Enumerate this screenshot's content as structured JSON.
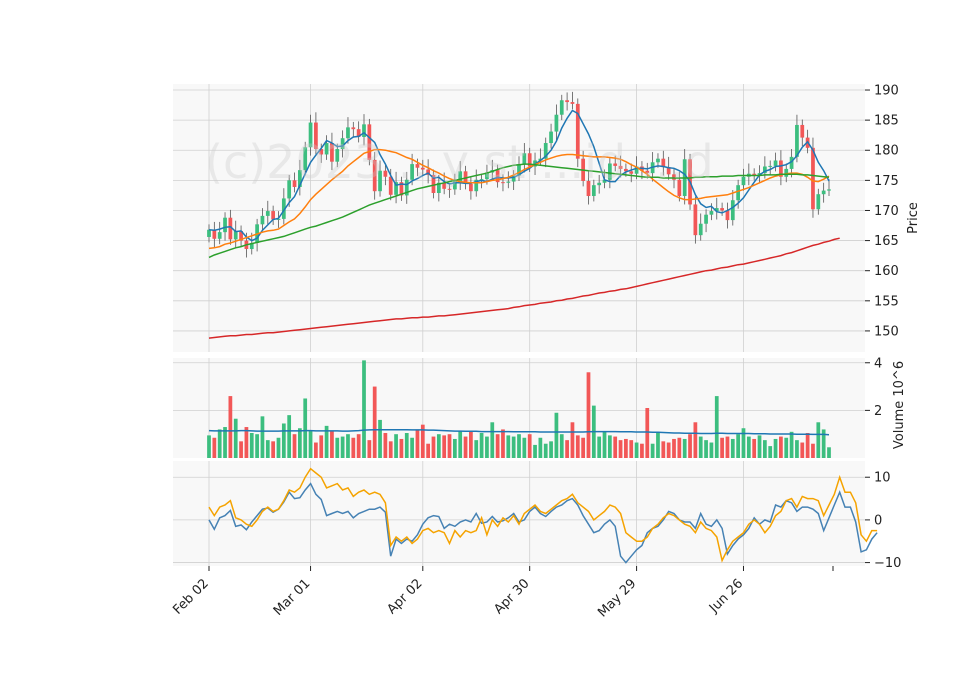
{
  "chart_data": {
    "type": "candlestick",
    "watermark": "(c)2023 ...y st ...id ...d",
    "x_tick_labels": [
      "Feb 02",
      "Mar 01",
      "Apr 02",
      "Apr 30",
      "May 29",
      "Jun 26"
    ],
    "x_tick_index": [
      0,
      19,
      40,
      60,
      80,
      100
    ],
    "colors": {
      "up": "#3cbe7f",
      "down": "#f25757",
      "ma_fast": "#1f77b4",
      "ma_mid": "#ff7f0e",
      "ma_slow": "#2ca02c",
      "ma_long": "#d62728",
      "vol_ma": "#1f77b4",
      "osc_a": "#4682b4",
      "osc_b": "#f5a300",
      "grid": "#d0d0d0",
      "panel_bg": "#f8f8f8"
    },
    "price_panel": {
      "ylabel": "Price",
      "ylim": [
        146.5,
        191
      ],
      "ticks": [
        150,
        155,
        160,
        165,
        170,
        175,
        180,
        185,
        190
      ],
      "close": [
        166.8,
        165.3,
        166.4,
        168.8,
        165.2,
        166.6,
        165.0,
        163.6,
        164.6,
        167.7,
        169.1,
        169.9,
        168.5,
        168.6,
        172.0,
        175.0,
        173.9,
        176.7,
        180.5,
        184.6,
        180.2,
        179.3,
        181.2,
        178.1,
        180.2,
        182.0,
        183.8,
        183.5,
        182.2,
        184.3,
        178.4,
        173.2,
        176.6,
        175.6,
        172.6,
        174.7,
        172.5,
        175.1,
        177.7,
        177.1,
        176.8,
        175.9,
        172.9,
        174.6,
        173.6,
        173.5,
        174.8,
        176.5,
        174.4,
        173.2,
        175.1,
        175.2,
        176.3,
        176.7,
        174.7,
        174.6,
        174.8,
        175.8,
        177.7,
        179.5,
        177.3,
        178.3,
        178.6,
        181.2,
        183.1,
        185.9,
        188.3,
        188.0,
        187.7,
        178.6,
        174.9,
        172.4,
        174.2,
        174.6,
        175.1,
        177.8,
        177.4,
        176.9,
        176.5,
        176.1,
        177.3,
        176.6,
        176.2,
        178.0,
        178.6,
        177.2,
        176.0,
        175.1,
        172.4,
        178.5,
        171.0,
        165.9,
        167.8,
        169.3,
        169.9,
        170.4,
        170.0,
        168.4,
        171.7,
        174.2,
        175.6,
        176.1,
        175.9,
        176.2,
        177.3,
        177.4,
        178.3,
        175.6,
        176.9,
        178.9,
        184.2,
        182.1,
        180.4,
        170.2,
        172.7,
        173.3,
        173.5
      ],
      "moving_averages": [
        {
          "period": 5,
          "values": [
            166.8,
            166.7,
            166.9,
            167.2,
            167.3,
            166.5,
            166.6,
            165.6,
            165.0,
            165.4,
            166.7,
            167.6,
            168.5,
            168.7,
            170.0,
            171.3,
            172.3,
            174.2,
            176.1,
            178.0,
            179.2,
            180.3,
            181.6,
            181.2,
            180.6,
            180.7,
            181.6,
            182.2,
            182.3,
            182.9,
            182.1,
            181.3,
            179.3,
            177.7,
            175.8,
            174.2,
            174.4,
            174.3,
            174.9,
            175.3,
            175.8,
            176.2,
            175.4,
            175.5,
            174.8,
            174.4,
            174.6,
            174.6,
            174.5,
            174.5,
            174.8,
            175.0,
            174.8,
            175.2,
            175.5,
            175.4,
            175.4,
            175.5,
            175.9,
            176.5,
            177.0,
            177.7,
            178.3,
            179.0,
            180.0,
            181.5,
            183.7,
            185.3,
            186.6,
            186.1,
            184.4,
            182.7,
            180.6,
            177.8,
            175.1,
            174.8,
            174.8,
            175.8,
            176.4,
            176.7,
            177.0,
            177.0,
            176.9,
            177.2,
            177.4,
            177.3,
            177.1,
            177.0,
            176.6,
            176.0,
            174.8,
            172.6,
            171.1,
            170.5,
            170.7,
            169.8,
            169.6,
            170.0,
            170.5,
            171.2,
            172.1,
            173.4,
            174.7,
            175.9,
            176.5,
            176.8,
            177.3,
            177.4,
            177.6,
            178.1,
            179.1,
            180.5,
            181.4,
            180.0,
            178.0,
            176.6,
            174.9
          ]
        },
        {
          "period": 20,
          "values": [
            163.7,
            163.8,
            164.0,
            164.4,
            164.6,
            164.9,
            165.2,
            165.5,
            165.8,
            166.1,
            166.4,
            166.6,
            166.7,
            166.9,
            167.5,
            168.1,
            168.6,
            169.5,
            170.6,
            171.8,
            172.7,
            173.5,
            174.3,
            175.1,
            175.8,
            176.5,
            177.4,
            178.1,
            178.8,
            179.5,
            179.8,
            180.1,
            180.1,
            180.0,
            179.8,
            179.6,
            179.2,
            178.8,
            178.5,
            178.0,
            177.5,
            177.1,
            176.6,
            176.2,
            175.7,
            175.3,
            175.0,
            174.8,
            174.7,
            174.6,
            174.6,
            174.6,
            174.8,
            175.0,
            175.1,
            175.3,
            175.5,
            175.9,
            176.3,
            176.8,
            177.2,
            177.6,
            178.0,
            178.4,
            178.7,
            179.0,
            179.2,
            179.3,
            179.3,
            179.2,
            179.1,
            179.0,
            178.9,
            178.9,
            178.9,
            178.8,
            178.7,
            178.5,
            178.1,
            177.6,
            177.2,
            176.6,
            176.0,
            175.2,
            174.5,
            173.8,
            173.1,
            172.5,
            172.1,
            171.8,
            171.8,
            171.9,
            172.0,
            172.2,
            172.3,
            172.4,
            172.5,
            172.6,
            172.9,
            173.2,
            173.5,
            173.8,
            174.2,
            174.6,
            175.0,
            175.4,
            175.7,
            175.9,
            176.1,
            176.2,
            176.2,
            176.0,
            175.5,
            174.9,
            174.8,
            175.2,
            175.7
          ]
        },
        {
          "period": 50,
          "values": [
            162.2,
            162.6,
            162.9,
            163.2,
            163.5,
            163.8,
            164.0,
            164.3,
            164.5,
            164.7,
            164.9,
            165.1,
            165.3,
            165.5,
            165.7,
            166.0,
            166.3,
            166.6,
            166.9,
            167.2,
            167.4,
            167.7,
            168.0,
            168.3,
            168.6,
            168.9,
            169.3,
            169.7,
            170.1,
            170.5,
            170.9,
            171.2,
            171.5,
            171.8,
            172.1,
            172.4,
            172.7,
            173.0,
            173.3,
            173.6,
            173.8,
            174.0,
            174.2,
            174.4,
            174.6,
            174.8,
            175.0,
            175.2,
            175.4,
            175.6,
            175.8,
            176.0,
            176.2,
            176.5,
            176.8,
            177.1,
            177.3,
            177.5,
            177.6,
            177.7,
            177.7,
            177.6,
            177.5,
            177.4,
            177.3,
            177.2,
            177.1,
            177.0,
            176.9,
            176.8,
            176.7,
            176.6,
            176.5,
            176.4,
            176.3,
            176.2,
            176.1,
            176.0,
            175.9,
            175.8,
            175.7,
            175.6,
            175.5,
            175.5,
            175.5,
            175.4,
            175.4,
            175.4,
            175.4,
            175.4,
            175.4,
            175.5,
            175.5,
            175.6,
            175.6,
            175.6,
            175.7,
            175.7,
            175.7,
            175.8,
            175.8,
            175.8,
            175.8,
            175.8,
            175.9,
            175.9,
            175.9,
            176.0,
            176.0,
            176.0,
            176.0,
            175.9,
            175.9,
            175.8,
            175.7,
            175.6,
            175.5
          ]
        },
        {
          "period": 200,
          "values": [
            148.8,
            148.9,
            149.0,
            149.1,
            149.2,
            149.2,
            149.3,
            149.4,
            149.4,
            149.5,
            149.6,
            149.7,
            149.7,
            149.8,
            149.9,
            150.0,
            150.1,
            150.2,
            150.3,
            150.4,
            150.5,
            150.6,
            150.7,
            150.8,
            150.9,
            151.0,
            151.1,
            151.2,
            151.3,
            151.4,
            151.5,
            151.6,
            151.7,
            151.8,
            151.9,
            152.0,
            152.0,
            152.1,
            152.2,
            152.2,
            152.3,
            152.3,
            152.4,
            152.5,
            152.5,
            152.6,
            152.7,
            152.8,
            152.9,
            153.0,
            153.1,
            153.2,
            153.3,
            153.4,
            153.5,
            153.6,
            153.7,
            153.9,
            154.0,
            154.2,
            154.3,
            154.4,
            154.6,
            154.7,
            154.8,
            155.0,
            155.1,
            155.3,
            155.4,
            155.6,
            155.8,
            155.9,
            156.1,
            156.3,
            156.4,
            156.6,
            156.7,
            156.9,
            157.0,
            157.2,
            157.4,
            157.6,
            157.8,
            158.0,
            158.2,
            158.4,
            158.6,
            158.8,
            159.0,
            159.2,
            159.4,
            159.6,
            159.8,
            160.0,
            160.1,
            160.3,
            160.5,
            160.6,
            160.8,
            161.0,
            161.1,
            161.3,
            161.5,
            161.7,
            161.9,
            162.1,
            162.3,
            162.5,
            162.8,
            163.0,
            163.3,
            163.6,
            163.9,
            164.2,
            164.4,
            164.7,
            164.9,
            165.2,
            165.4
          ]
        }
      ]
    },
    "volume_panel": {
      "ylabel": "Volume  10^6",
      "ylim": [
        0,
        4.2
      ],
      "ticks": [
        2,
        4
      ],
      "values": [
        0.95,
        0.85,
        1.2,
        1.3,
        2.6,
        1.65,
        0.7,
        1.3,
        1.05,
        1.0,
        1.75,
        0.75,
        0.7,
        0.85,
        1.45,
        1.8,
        1.0,
        1.25,
        2.5,
        1.15,
        0.65,
        0.95,
        1.35,
        1.15,
        0.85,
        0.9,
        1.0,
        0.85,
        1.0,
        4.1,
        0.75,
        3.0,
        1.6,
        1.05,
        0.7,
        1.0,
        0.8,
        1.05,
        0.85,
        1.2,
        1.4,
        0.6,
        0.9,
        1.0,
        0.95,
        1.0,
        0.8,
        1.15,
        0.9,
        1.1,
        0.75,
        1.05,
        0.9,
        1.5,
        1.0,
        1.2,
        0.95,
        0.9,
        1.0,
        0.85,
        1.0,
        0.55,
        0.85,
        0.6,
        0.7,
        1.9,
        1.0,
        0.75,
        1.5,
        0.95,
        0.85,
        3.6,
        2.2,
        0.9,
        1.1,
        0.95,
        0.9,
        0.75,
        0.8,
        0.75,
        0.65,
        0.6,
        2.1,
        0.6,
        1.1,
        0.7,
        0.65,
        0.8,
        0.85,
        0.8,
        1.0,
        1.5,
        0.9,
        0.75,
        0.65,
        2.6,
        0.85,
        0.9,
        0.8,
        1.0,
        1.25,
        0.9,
        0.8,
        0.95,
        0.75,
        0.5,
        0.8,
        0.9,
        0.85,
        1.1,
        0.75,
        0.65,
        1.05,
        0.6,
        1.5,
        1.2,
        0.45
      ],
      "ma_values": [
        1.15,
        1.14,
        1.14,
        1.14,
        1.14,
        1.14,
        1.15,
        1.15,
        1.14,
        1.13,
        1.13,
        1.13,
        1.13,
        1.13,
        1.14,
        1.14,
        1.14,
        1.14,
        1.15,
        1.15,
        1.14,
        1.14,
        1.14,
        1.14,
        1.14,
        1.13,
        1.13,
        1.14,
        1.15,
        1.17,
        1.18,
        1.19,
        1.19,
        1.19,
        1.19,
        1.19,
        1.19,
        1.19,
        1.18,
        1.18,
        1.18,
        1.17,
        1.17,
        1.16,
        1.15,
        1.14,
        1.13,
        1.13,
        1.12,
        1.12,
        1.12,
        1.11,
        1.11,
        1.11,
        1.11,
        1.11,
        1.11,
        1.1,
        1.1,
        1.1,
        1.1,
        1.1,
        1.09,
        1.09,
        1.09,
        1.09,
        1.09,
        1.09,
        1.09,
        1.09,
        1.09,
        1.1,
        1.11,
        1.11,
        1.11,
        1.11,
        1.11,
        1.1,
        1.1,
        1.1,
        1.09,
        1.09,
        1.09,
        1.08,
        1.08,
        1.07,
        1.06,
        1.05,
        1.05,
        1.04,
        1.04,
        1.04,
        1.03,
        1.03,
        1.03,
        1.04,
        1.04,
        1.03,
        1.03,
        1.03,
        1.03,
        1.03,
        1.02,
        1.02,
        1.02,
        1.01,
        1.01,
        1.01,
        1.01,
        1.01,
        1.0,
        1.0,
        1.0,
        0.99,
        0.99,
        0.99,
        0.98
      ]
    },
    "oscillator_panel": {
      "ylim": [
        -10.8,
        13.8
      ],
      "ticks": [
        10,
        0,
        -10
      ],
      "series_a": [
        0,
        -2.2,
        0.5,
        1.0,
        2.2,
        -1.5,
        -1.2,
        -2.3,
        -0.5,
        1.0,
        2.5,
        2.8,
        1.8,
        2.5,
        4.2,
        6.5,
        5.0,
        5.2,
        7.0,
        8.5,
        6.0,
        4.8,
        1.0,
        1.5,
        2.0,
        1.5,
        2.0,
        0.5,
        1.5,
        2.0,
        2.5,
        2.5,
        3.0,
        1.8,
        -8.5,
        -4.5,
        -5.5,
        -4.5,
        -5.0,
        -3.5,
        -1.0,
        0.5,
        1.0,
        0.8,
        -2.0,
        -1.0,
        -1.5,
        -0.5,
        0.0,
        -0.5,
        1.5,
        -0.8,
        -0.5,
        0.8,
        -0.5,
        -0.2,
        0.5,
        1.5,
        -0.5,
        0.0,
        2.0,
        3.0,
        1.5,
        0.8,
        2.0,
        3.0,
        3.5,
        4.5,
        5.0,
        3.5,
        1.0,
        -1.0,
        -3.0,
        -2.5,
        -1.0,
        0.0,
        -1.5,
        -8.5,
        -10.0,
        -8.5,
        -7.0,
        -6.0,
        -3.0,
        -2.0,
        -1.5,
        0.0,
        2.0,
        1.5,
        0.0,
        -0.5,
        -0.5,
        -2.0,
        1.5,
        -1.0,
        -1.5,
        0.0,
        -2.0,
        -8.0,
        -6.0,
        -4.5,
        -3.5,
        -2.0,
        0.5,
        -1.0,
        0.0,
        -0.5,
        3.5,
        3.0,
        4.5,
        4.0,
        2.0,
        3.0,
        3.0,
        2.5,
        1.5,
        -2.5,
        0.5,
        3.5,
        6.5,
        3.0,
        3.0,
        -0.5,
        -7.5,
        -7.0,
        -4.5,
        -3.0
      ],
      "series_b": [
        3.0,
        1.0,
        3.0,
        3.5,
        4.5,
        0.5,
        0.0,
        -1.0,
        -1.5,
        0.0,
        2.0,
        3.0,
        2.0,
        2.5,
        4.5,
        7.0,
        6.5,
        7.5,
        10.0,
        12.0,
        11.0,
        10.0,
        7.5,
        8.0,
        8.5,
        7.0,
        7.5,
        5.5,
        6.5,
        7.0,
        6.0,
        6.5,
        6.0,
        4.0,
        -6.0,
        -4.0,
        -5.0,
        -4.0,
        -5.5,
        -4.5,
        -2.5,
        -2.0,
        -3.0,
        -2.5,
        -3.0,
        -5.5,
        -2.5,
        -4.0,
        -2.5,
        -3.0,
        -2.5,
        0.5,
        -3.5,
        0.0,
        -1.5,
        0.5,
        -0.5,
        1.0,
        -1.0,
        1.5,
        2.5,
        3.5,
        2.0,
        1.5,
        2.5,
        3.5,
        4.5,
        5.0,
        6.0,
        4.0,
        3.0,
        2.0,
        0.0,
        1.0,
        2.0,
        3.5,
        3.0,
        1.5,
        -3.0,
        -4.0,
        -5.0,
        -5.0,
        -4.0,
        -2.0,
        -1.0,
        0.5,
        1.5,
        1.0,
        0.0,
        -1.0,
        -1.5,
        -3.0,
        -0.5,
        -2.0,
        -2.5,
        -4.0,
        -9.5,
        -7.0,
        -5.0,
        -4.0,
        -3.0,
        -1.0,
        0.0,
        -1.0,
        -3.0,
        -1.5,
        1.0,
        2.0,
        4.5,
        5.0,
        3.0,
        5.5,
        5.0,
        5.0,
        4.5,
        1.0,
        3.5,
        6.0,
        10.0,
        6.5,
        6.5,
        4.0,
        -3.5,
        -5.0,
        -2.5,
        -2.5
      ]
    }
  }
}
